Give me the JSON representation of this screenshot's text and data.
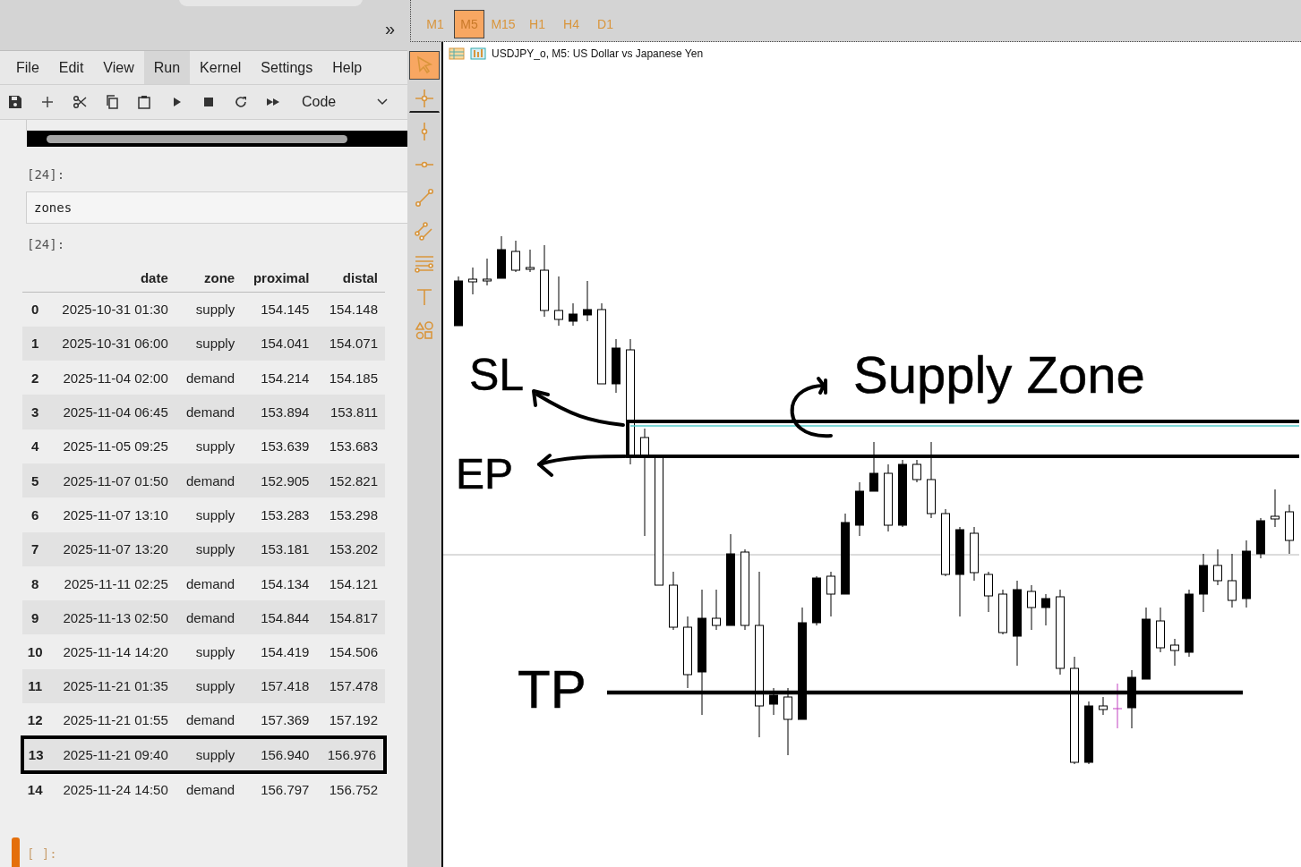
{
  "notebook": {
    "collapse_button": "»",
    "menu": [
      {
        "label": "File",
        "selected": false
      },
      {
        "label": "Edit",
        "selected": false
      },
      {
        "label": "View",
        "selected": false
      },
      {
        "label": "Run",
        "selected": true
      },
      {
        "label": "Kernel",
        "selected": false
      },
      {
        "label": "Settings",
        "selected": false
      },
      {
        "label": "Help",
        "selected": false
      }
    ],
    "cell_type": "Code",
    "input_cell": {
      "prompt": "[24]:",
      "code": "zones"
    },
    "output_cell": {
      "prompt": "[24]:",
      "table": {
        "columns": [
          "",
          "date",
          "zone",
          "proximal",
          "distal"
        ],
        "rows": [
          {
            "index": "0",
            "date": "2025-10-31 01:30",
            "zone": "supply",
            "proximal": "154.145",
            "distal": "154.148",
            "highlighted": false
          },
          {
            "index": "1",
            "date": "2025-10-31 06:00",
            "zone": "supply",
            "proximal": "154.041",
            "distal": "154.071",
            "highlighted": false
          },
          {
            "index": "2",
            "date": "2025-11-04 02:00",
            "zone": "demand",
            "proximal": "154.214",
            "distal": "154.185",
            "highlighted": false
          },
          {
            "index": "3",
            "date": "2025-11-04 06:45",
            "zone": "demand",
            "proximal": "153.894",
            "distal": "153.811",
            "highlighted": false
          },
          {
            "index": "4",
            "date": "2025-11-05 09:25",
            "zone": "supply",
            "proximal": "153.639",
            "distal": "153.683",
            "highlighted": false
          },
          {
            "index": "5",
            "date": "2025-11-07 01:50",
            "zone": "demand",
            "proximal": "152.905",
            "distal": "152.821",
            "highlighted": false
          },
          {
            "index": "6",
            "date": "2025-11-07 13:10",
            "zone": "supply",
            "proximal": "153.283",
            "distal": "153.298",
            "highlighted": false
          },
          {
            "index": "7",
            "date": "2025-11-07 13:20",
            "zone": "supply",
            "proximal": "153.181",
            "distal": "153.202",
            "highlighted": false
          },
          {
            "index": "8",
            "date": "2025-11-11 02:25",
            "zone": "demand",
            "proximal": "154.134",
            "distal": "154.121",
            "highlighted": false
          },
          {
            "index": "9",
            "date": "2025-11-13 02:50",
            "zone": "demand",
            "proximal": "154.844",
            "distal": "154.817",
            "highlighted": false
          },
          {
            "index": "10",
            "date": "2025-11-14 14:20",
            "zone": "supply",
            "proximal": "154.419",
            "distal": "154.506",
            "highlighted": false
          },
          {
            "index": "11",
            "date": "2025-11-21 01:35",
            "zone": "supply",
            "proximal": "157.418",
            "distal": "157.478",
            "highlighted": false
          },
          {
            "index": "12",
            "date": "2025-11-21 01:55",
            "zone": "demand",
            "proximal": "157.369",
            "distal": "157.192",
            "highlighted": false
          },
          {
            "index": "13",
            "date": "2025-11-21 09:40",
            "zone": "supply",
            "proximal": "156.940",
            "distal": "156.976",
            "highlighted": true
          },
          {
            "index": "14",
            "date": "2025-11-24 14:50",
            "zone": "demand",
            "proximal": "156.797",
            "distal": "156.752",
            "highlighted": false
          }
        ]
      }
    },
    "empty_cell": {
      "prompt": "[ ]:",
      "active": true
    }
  },
  "terminal": {
    "timeframes": [
      {
        "label": "M1",
        "selected": false
      },
      {
        "label": "M5",
        "selected": true
      },
      {
        "label": "M15",
        "selected": false
      },
      {
        "label": "H1",
        "selected": false
      },
      {
        "label": "H4",
        "selected": false
      },
      {
        "label": "D1",
        "selected": false
      }
    ],
    "tools": [
      {
        "kind": "cursor",
        "selected": true
      },
      {
        "kind": "crosshair",
        "selected": false
      },
      {
        "kind": "vline",
        "selected": false
      },
      {
        "kind": "hline",
        "selected": false
      },
      {
        "kind": "trend",
        "selected": false
      },
      {
        "kind": "channel",
        "selected": false
      },
      {
        "kind": "fibo",
        "selected": false
      },
      {
        "kind": "text",
        "selected": false
      },
      {
        "kind": "shapes",
        "selected": false
      }
    ],
    "chart_title": "USDJPY_o, M5:  US Dollar vs Japanese Yen",
    "annotations": [
      "SL",
      "EP",
      "TP",
      "Supply Zone"
    ]
  }
}
